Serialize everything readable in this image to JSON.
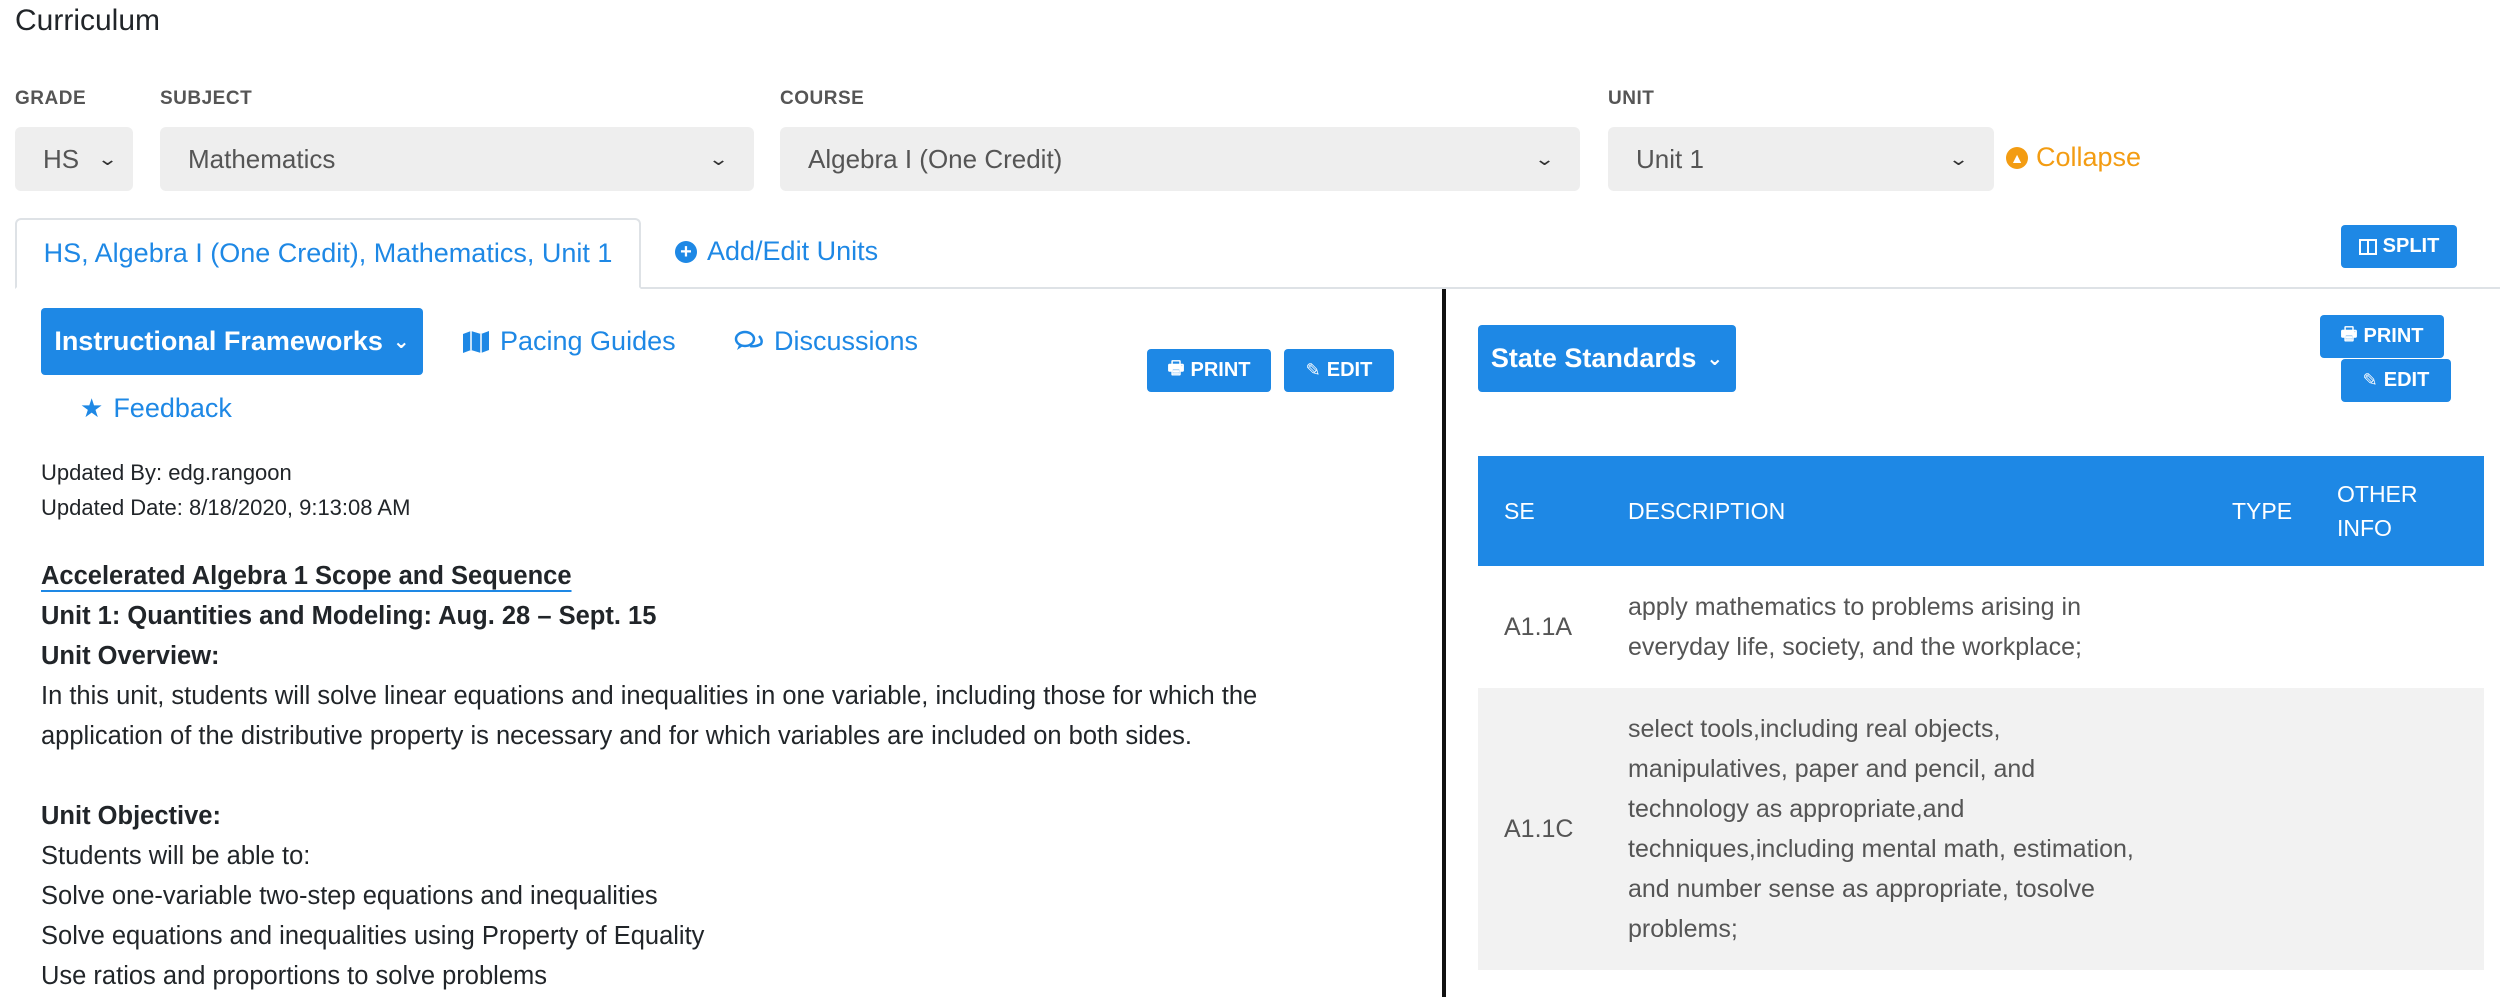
{
  "page_title": "Curriculum",
  "filters": {
    "grade": {
      "label": "GRADE",
      "value": "HS"
    },
    "subject": {
      "label": "SUBJECT",
      "value": "Mathematics"
    },
    "course": {
      "label": "COURSE",
      "value": "Algebra I (One Credit)"
    },
    "unit": {
      "label": "UNIT",
      "value": "Unit 1"
    },
    "collapse_label": "Collapse"
  },
  "tabs": {
    "active": "HS, Algebra I (One Credit), Mathematics, Unit 1",
    "add_edit": "Add/Edit Units",
    "split": "SPLIT"
  },
  "left": {
    "frameworks_button": "Instructional Frameworks",
    "pacing_guides": "Pacing Guides",
    "discussions": "Discussions",
    "feedback": "Feedback",
    "print": "PRINT",
    "edit": "EDIT",
    "updated_by_label": "Updated By:",
    "updated_by": "edg.rangoon",
    "updated_date_label": "Updated Date:",
    "updated_date": "8/18/2020, 9:13:08 AM",
    "doc": {
      "title": "Accelerated Algebra 1 Scope and Sequence",
      "unit_heading": "Unit 1: Quantities and Modeling: Aug. 28 – Sept. 15",
      "overview_heading": "Unit Overview:",
      "overview_line1": "In this unit, students will solve linear equations and inequalities in one variable, including those for which the",
      "overview_line2": "application of the distributive property is necessary and for which variables are included on both sides.",
      "objective_heading": "Unit Objective:",
      "objective_intro": "Students will be able to:",
      "objectives": [
        "Solve one-variable two-step equations and inequalities",
        "Solve equations and inequalities using Property of Equality",
        "Use ratios and proportions to solve problems"
      ]
    }
  },
  "right": {
    "standards_button": "State Standards",
    "print": "PRINT",
    "edit": "EDIT",
    "table": {
      "headers": [
        "SE",
        "DESCRIPTION",
        "TYPE",
        "OTHER INFO"
      ],
      "rows": [
        {
          "se": "A1.1A",
          "lines": [
            "apply mathematics to problems arising in",
            "everyday life, society, and the workplace;"
          ],
          "type": "",
          "other": ""
        },
        {
          "se": "A1.1C",
          "lines": [
            "select tools,including real objects,",
            "manipulatives, paper and pencil, and",
            "technology as appropriate,and",
            "techniques,including mental math, estimation,",
            "and number sense as appropriate, tosolve",
            "problems;"
          ],
          "type": "",
          "other": ""
        }
      ]
    }
  },
  "colors": {
    "primary": "#1e88e5",
    "accent": "#f39c12",
    "select_bg": "#eeeeee",
    "row_alt": "#f2f2f2"
  }
}
